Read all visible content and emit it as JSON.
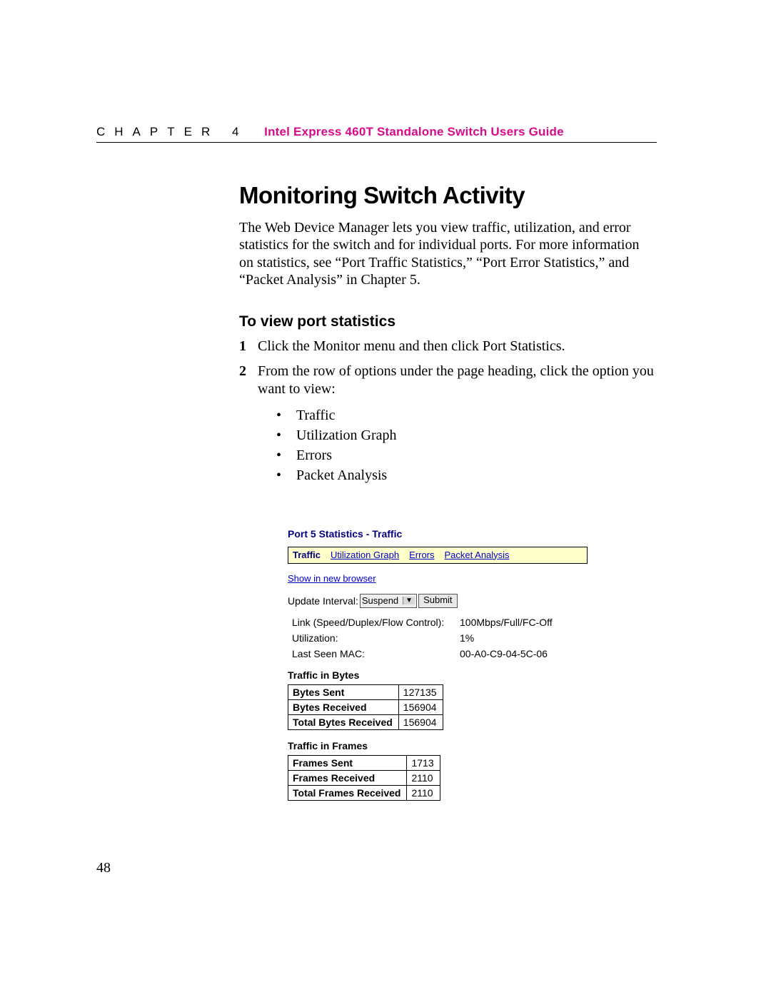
{
  "header": {
    "chapter": "CHAPTER 4",
    "guide_title": "Intel Express 460T Standalone Switch Users Guide"
  },
  "section": {
    "title": "Monitoring Switch Activity",
    "intro": "The Web Device Manager lets you view traffic, utilization, and error statistics for the switch and for individual ports. For more information on statistics, see “Port Traffic Statistics,” “Port Error Statistics,” and “Packet Analysis” in Chapter 5."
  },
  "subsection": {
    "title": "To view port statistics",
    "steps": [
      {
        "num": "1",
        "text": "Click the Monitor menu and then click Port Statistics."
      },
      {
        "num": "2",
        "text": "From the row of options under the page heading, click the option you want to view:"
      }
    ],
    "bullets": [
      "Traffic",
      "Utilization Graph",
      "Errors",
      "Packet Analysis"
    ]
  },
  "figure": {
    "title": "Port 5 Statistics - Traffic",
    "tabs": {
      "active": "Traffic",
      "others": [
        "Utilization Graph",
        "Errors",
        "Packet Analysis"
      ]
    },
    "new_browser": "Show in new browser",
    "update_label": "Update Interval:",
    "update_value": "Suspend",
    "submit_label": "Submit",
    "summary": [
      {
        "label": "Link (Speed/Duplex/Flow Control):",
        "value": "100Mbps/Full/FC-Off"
      },
      {
        "label": "Utilization:",
        "value": "1%"
      },
      {
        "label": "Last Seen MAC:",
        "value": "00-A0-C9-04-5C-06"
      }
    ],
    "bytes_title": "Traffic in Bytes",
    "bytes_rows": [
      {
        "k": "Bytes Sent",
        "v": "127135"
      },
      {
        "k": "Bytes Received",
        "v": "156904"
      },
      {
        "k": "Total Bytes Received",
        "v": "156904"
      }
    ],
    "frames_title": "Traffic in Frames",
    "frames_rows": [
      {
        "k": "Frames Sent",
        "v": "1713"
      },
      {
        "k": "Frames Received",
        "v": "2110"
      },
      {
        "k": "Total Frames Received",
        "v": "2110"
      }
    ]
  },
  "page_number": "48"
}
